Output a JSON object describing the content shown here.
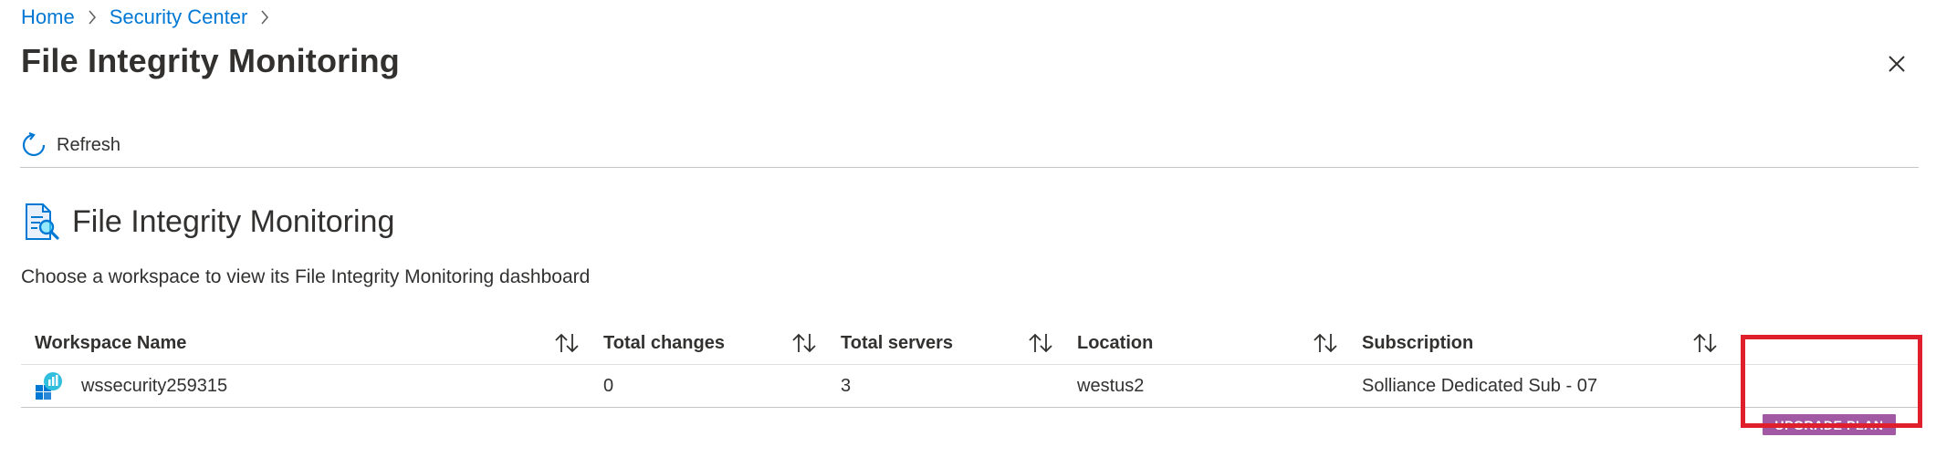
{
  "breadcrumb": {
    "items": [
      "Home",
      "Security Center"
    ]
  },
  "header": {
    "title": "File Integrity Monitoring"
  },
  "toolbar": {
    "refresh_label": "Refresh"
  },
  "section": {
    "title": "File Integrity Monitoring",
    "description": "Choose a workspace to view its File Integrity Monitoring dashboard"
  },
  "table": {
    "columns": [
      "Workspace Name",
      "Total changes",
      "Total servers",
      "Location",
      "Subscription"
    ],
    "rows": [
      {
        "workspace": "wssecurity259315",
        "total_changes": "0",
        "total_servers": "3",
        "location": "westus2",
        "subscription": "Solliance Dedicated Sub - 07",
        "action": "UPGRADE PLAN"
      }
    ]
  },
  "colors": {
    "link": "#0078d4",
    "upgrade_button": "#a259a4",
    "highlight": "#e01f2d"
  },
  "icons": [
    "chevron-right-icon",
    "close-icon",
    "refresh-icon",
    "file-search-icon",
    "sort-icon",
    "workspace-icon"
  ]
}
